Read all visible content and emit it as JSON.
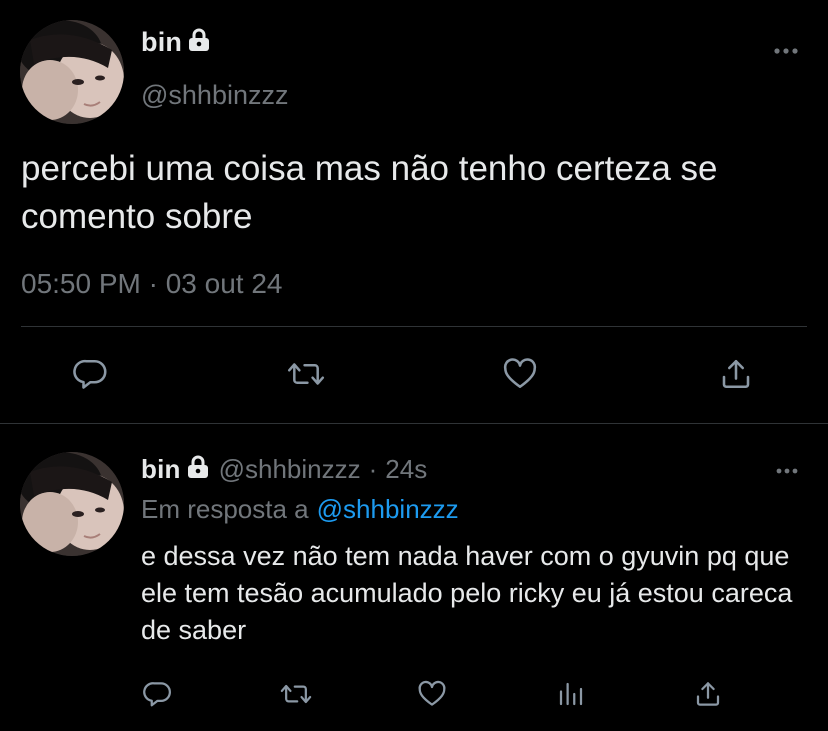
{
  "main_tweet": {
    "display_name": "bin",
    "handle": "@shhbinzzz",
    "text": "percebi uma coisa mas não tenho certeza se comento sobre",
    "timestamp": "05:50 PM · 03 out 24",
    "actions": [
      "reply-icon",
      "retweet-icon",
      "like-icon",
      "share-icon"
    ]
  },
  "reply_tweet": {
    "display_name": "bin",
    "handle": "@shhbinzzz",
    "separator": "·",
    "age": "24s",
    "reply_prefix": "Em resposta a",
    "reply_mention": "@shhbinzzz",
    "text": "e dessa vez não tem nada haver com o gyuvin pq que ele tem tesão acumulado pelo ricky eu já estou careca de saber",
    "actions": [
      "reply-icon",
      "retweet-icon",
      "like-icon",
      "views-icon",
      "share-icon"
    ]
  },
  "colors": {
    "background": "#000000",
    "primary_text": "#e7e9ea",
    "secondary_text": "#71767b",
    "divider": "#2f3336",
    "link": "#1d9bf0"
  }
}
